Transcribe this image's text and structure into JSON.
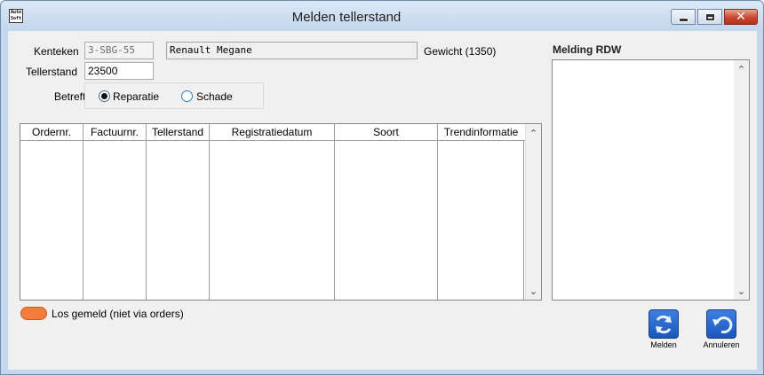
{
  "window": {
    "title": "Melden tellerstand",
    "icon": "app-logo-icon",
    "icon_text": "Auto\nSoft"
  },
  "form": {
    "kenteken_label": "Kenteken",
    "kenteken_value": "3-SBG-55",
    "model_value": "Renault Megane",
    "gewicht_label": "Gewicht (1350)",
    "tellerstand_label": "Tellerstand",
    "tellerstand_value": "23500",
    "betreft_label": "Betreft",
    "options": {
      "reparatie": "Reparatie",
      "schade": "Schade"
    },
    "selected_option": "Reparatie"
  },
  "table": {
    "columns": [
      "Ordernr.",
      "Factuurnr.",
      "Tellerstand",
      "Registratiedatum",
      "Soort",
      "Trendinformatie"
    ],
    "rows": []
  },
  "rdw": {
    "title": "Melding RDW",
    "content": ""
  },
  "legend": {
    "text": "Los gemeld (niet via orders)",
    "color": "#f47c3c"
  },
  "buttons": {
    "melden": "Melden",
    "annuleren": "Annuleren"
  },
  "colors": {
    "accent": "#1b57b8",
    "close": "#c9462e"
  }
}
